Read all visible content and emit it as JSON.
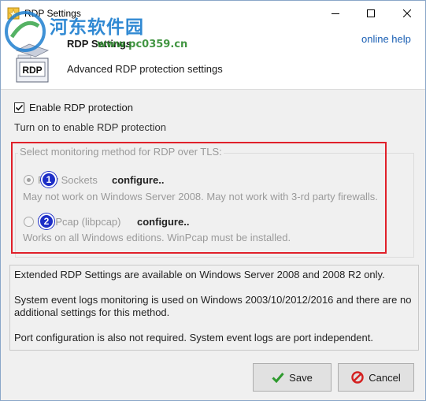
{
  "window": {
    "title": "RDP Settings",
    "controls": {
      "minimize": "minimize-icon",
      "maximize": "maximize-icon",
      "close": "close-icon"
    }
  },
  "watermark": {
    "brand": "河东软件园",
    "url": "www.pc0359.cn"
  },
  "header": {
    "logo_text": "RDP",
    "title": "RDP Settings",
    "subtitle": "Advanced RDP protection settings",
    "help_link": "online help"
  },
  "protection": {
    "enabled": true,
    "checkbox_label": "Enable RDP protection",
    "hint": "Turn on to enable RDP protection"
  },
  "monitoring": {
    "legend": "Select monitoring method for RDP over TLS:",
    "options": [
      {
        "badge": "1",
        "label": "Raw Sockets",
        "configure_label": "configure..",
        "description": "May not work on Windows Server 2008. May not work with 3-rd party firewalls.",
        "selected": true
      },
      {
        "badge": "2",
        "label": "WinPcap (libpcap)",
        "configure_label": "configure..",
        "description": "Works on all Windows editions. WinPcap must be installed.",
        "selected": false
      }
    ]
  },
  "info": {
    "lines": [
      "Extended RDP Settings are available on Windows Server 2008 and 2008 R2 only.",
      "System event logs monitoring is used on Windows 2003/10/2012/2016 and there are no additional settings for this method.",
      "Port configuration is also not required. System event logs are port independent."
    ]
  },
  "buttons": {
    "save_label": "Save",
    "cancel_label": "Cancel"
  },
  "colors": {
    "highlight_box": "#e0202a",
    "badge": "#1d2ec7",
    "link": "#1a5fb4",
    "save_icon": "#2e9a2e",
    "cancel_icon": "#d42020"
  }
}
